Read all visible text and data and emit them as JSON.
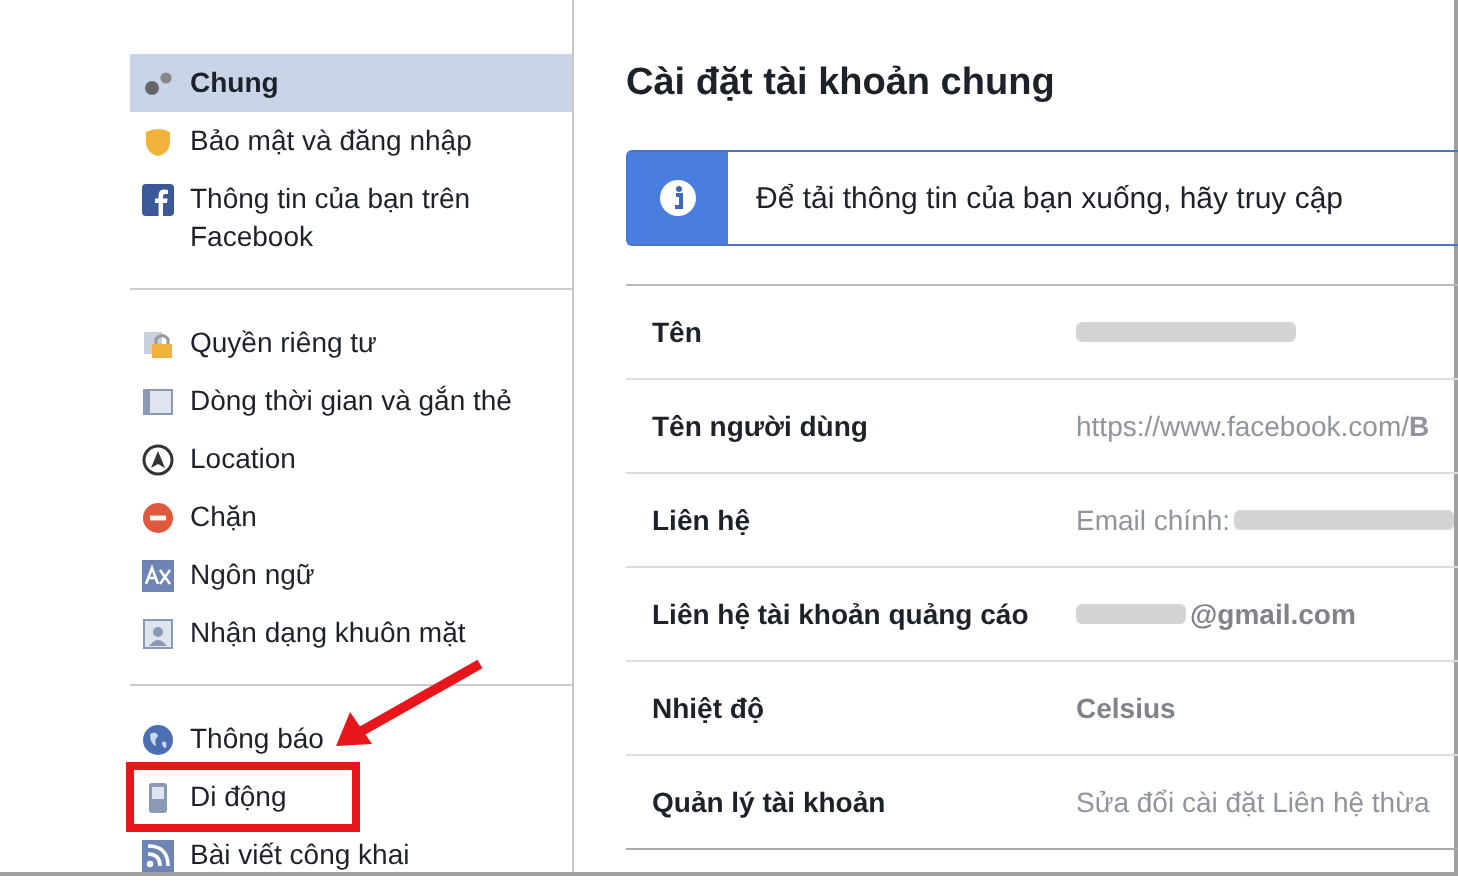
{
  "sidebar": {
    "groups": [
      {
        "items": [
          {
            "label": "Chung",
            "selected": true,
            "annotated": false
          },
          {
            "label": "Bảo mật và đăng nhập",
            "selected": false,
            "annotated": false
          },
          {
            "label": "Thông tin của bạn trên Facebook",
            "selected": false,
            "annotated": false
          }
        ]
      },
      {
        "items": [
          {
            "label": "Quyền riêng tư",
            "selected": false,
            "annotated": false
          },
          {
            "label": "Dòng thời gian và gắn thẻ",
            "selected": false,
            "annotated": false
          },
          {
            "label": "Location",
            "selected": false,
            "annotated": false
          },
          {
            "label": "Chặn",
            "selected": false,
            "annotated": false
          },
          {
            "label": "Ngôn ngữ",
            "selected": false,
            "annotated": false
          },
          {
            "label": "Nhận dạng khuôn mặt",
            "selected": false,
            "annotated": false
          }
        ]
      },
      {
        "items": [
          {
            "label": "Thông báo",
            "selected": false,
            "annotated": false
          },
          {
            "label": "Di động",
            "selected": false,
            "annotated": true
          },
          {
            "label": "Bài viết công khai",
            "selected": false,
            "annotated": false
          }
        ]
      }
    ]
  },
  "main": {
    "title": "Cài đặt tài khoản chung",
    "notice": "Để tải thông tin của bạn xuống, hãy truy cập",
    "rows": [
      {
        "label": "Tên",
        "value": [
          {
            "kind": "blur"
          }
        ]
      },
      {
        "label": "Tên người dùng",
        "value": [
          {
            "kind": "text",
            "text": "https://www.facebook.com/**B**"
          }
        ]
      },
      {
        "label": "Liên hệ",
        "value": [
          {
            "kind": "text",
            "text": "Email chính:"
          },
          {
            "kind": "blur"
          }
        ]
      },
      {
        "label": "Liên hệ tài khoản quảng cáo",
        "value": [
          {
            "kind": "blur"
          },
          {
            "kind": "bold",
            "text": "@gmail.com"
          }
        ]
      },
      {
        "label": "Nhiệt độ",
        "value": [
          {
            "kind": "bold",
            "text": "Celsius"
          }
        ]
      },
      {
        "label": "Quản lý tài khoản",
        "value": [
          {
            "kind": "text",
            "text": "Sửa đổi cài đặt Liên hệ thừa"
          }
        ]
      }
    ]
  }
}
